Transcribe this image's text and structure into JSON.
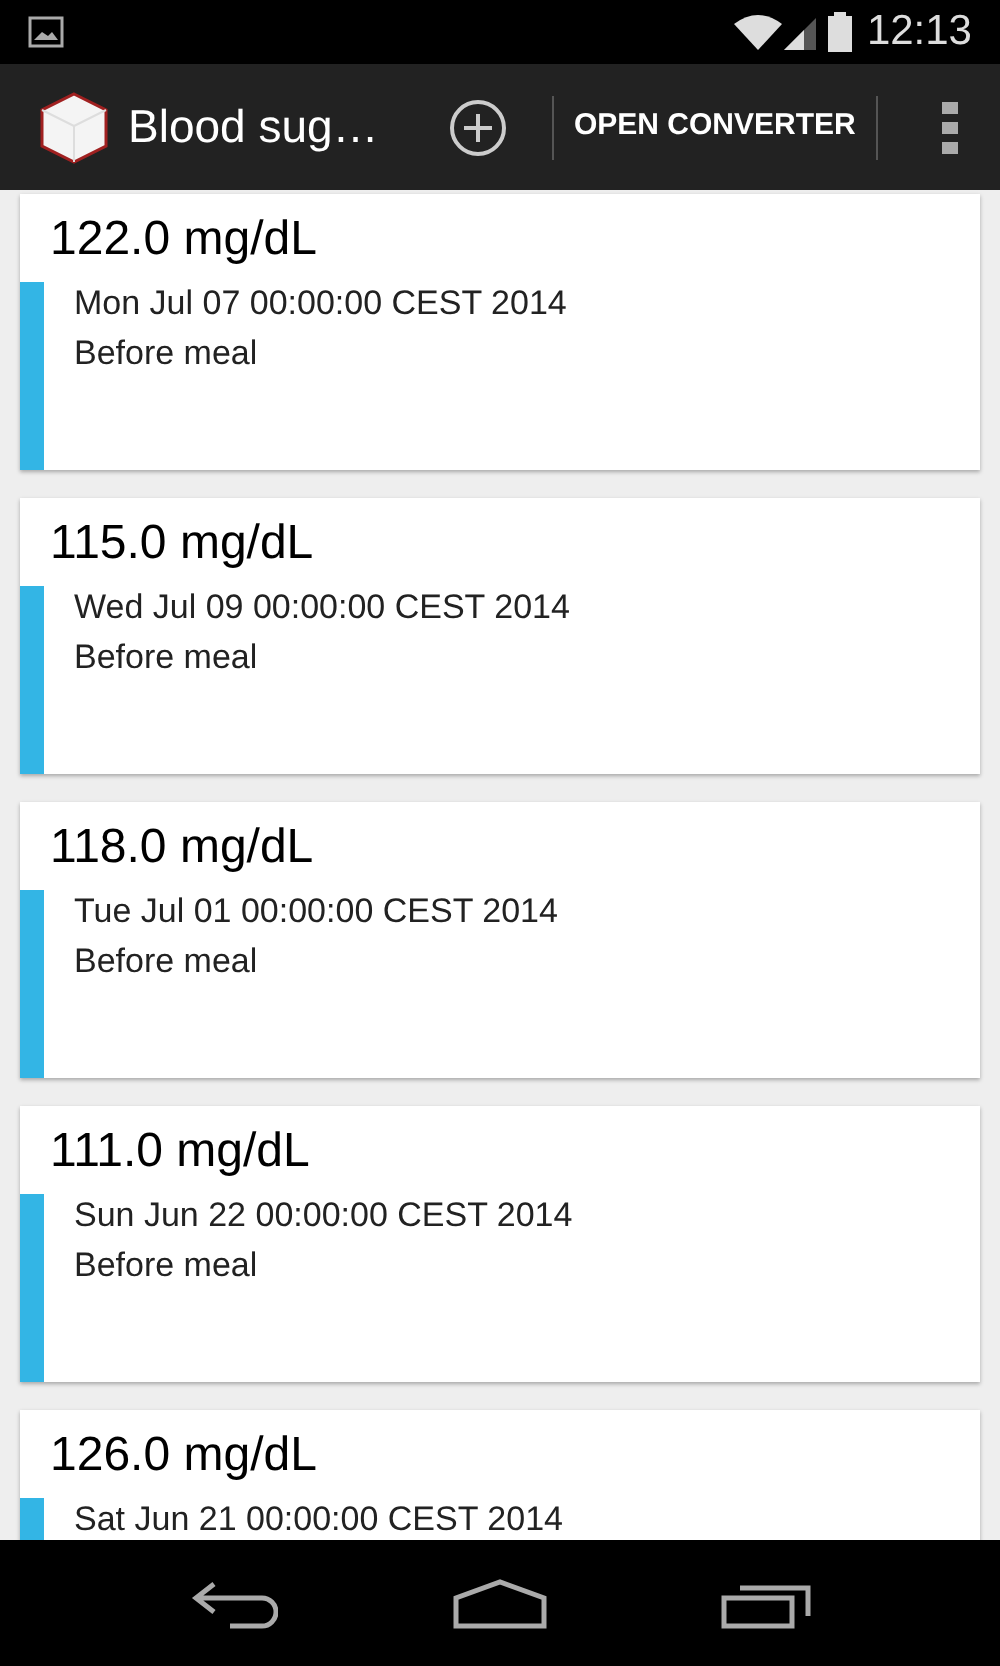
{
  "status_bar": {
    "time": "12:13"
  },
  "action_bar": {
    "title": "Blood sug…",
    "action": "OPEN CONVERTER"
  },
  "readings": [
    {
      "value": "122.0 mg/dL",
      "date": "Mon Jul 07 00:00:00 CEST 2014",
      "note": "Before meal"
    },
    {
      "value": "115.0 mg/dL",
      "date": "Wed Jul 09 00:00:00 CEST 2014",
      "note": "Before meal"
    },
    {
      "value": "118.0 mg/dL",
      "date": "Tue Jul 01 00:00:00 CEST 2014",
      "note": "Before meal"
    },
    {
      "value": "111.0 mg/dL",
      "date": "Sun Jun 22 00:00:00 CEST 2014",
      "note": "Before meal"
    },
    {
      "value": "126.0 mg/dL",
      "date": "Sat Jun 21 00:00:00 CEST 2014"
    }
  ]
}
